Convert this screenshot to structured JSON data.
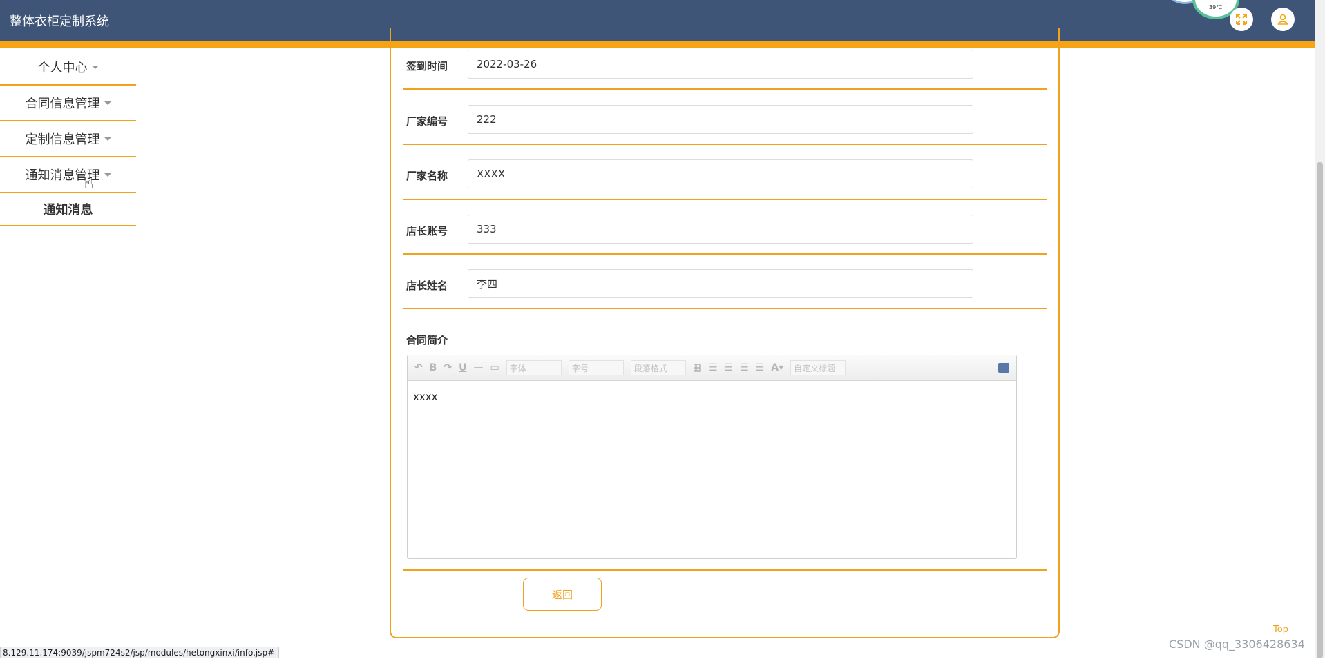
{
  "app": {
    "title": "整体衣柜定制系统"
  },
  "weather": {
    "temp": "39℃"
  },
  "header_icons": [
    "fullscreen-icon",
    "user-icon"
  ],
  "sidebar": {
    "items": [
      {
        "label": "个人中心",
        "has_caret": true
      },
      {
        "label": "合同信息管理",
        "has_caret": true
      },
      {
        "label": "定制信息管理",
        "has_caret": true
      },
      {
        "label": "通知消息管理",
        "has_caret": true
      },
      {
        "label": "通知消息",
        "has_caret": false
      }
    ]
  },
  "form": {
    "fields": [
      {
        "label": "签到时间",
        "value": "2022-03-26"
      },
      {
        "label": "厂家编号",
        "value": "222"
      },
      {
        "label": "厂家名称",
        "value": "XXXX"
      },
      {
        "label": "店长账号",
        "value": "333"
      },
      {
        "label": "店长姓名",
        "value": "李四"
      }
    ],
    "editor_label": "合同简介",
    "editor_toolbar": {
      "font": "字体",
      "size": "字号",
      "paragraph": "段落格式",
      "custom_title": "自定义标题"
    },
    "editor_content": "xxxx",
    "back_label": "返回"
  },
  "status_bar": {
    "url": "8.129.11.174:9039/jspm724s2/jsp/modules/hetongxinxi/info.jsp#"
  },
  "top_link": "Top",
  "watermark": "CSDN @qq_3306428634"
}
